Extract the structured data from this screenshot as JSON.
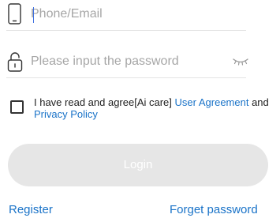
{
  "account_field": {
    "placeholder": "Phone/Email",
    "icon": "phone-icon"
  },
  "password_field": {
    "placeholder": "Please input the password",
    "icon": "lock-icon",
    "toggle_icon": "eye-closed-icon"
  },
  "agreement": {
    "prefix": "I have read and agree[Ai care] ",
    "user_agreement": "User Agreement",
    "connector": " and ",
    "privacy_policy": "Privacy Policy",
    "checked": false
  },
  "login_button": {
    "label": "Login",
    "enabled": false
  },
  "links": {
    "register": "Register",
    "forgot_password": "Forget password"
  },
  "colors": {
    "link": "#1a73c8",
    "button_disabled": "#e6e6e6",
    "caret": "#3d6fe0"
  }
}
